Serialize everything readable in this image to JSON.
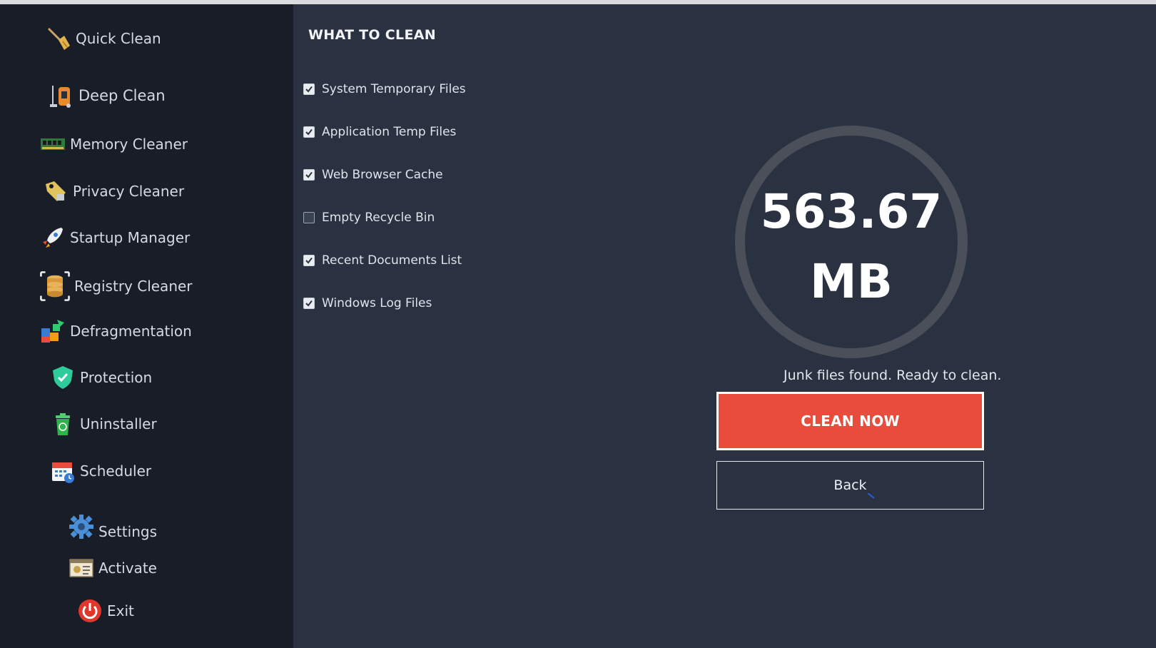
{
  "sidebar": {
    "items": [
      {
        "label": "Quick Clean",
        "icon": "broom-icon"
      },
      {
        "label": "Deep Clean",
        "icon": "vacuum-icon"
      },
      {
        "label": "Memory Cleaner",
        "icon": "ram-chip-icon"
      },
      {
        "label": "Privacy Cleaner",
        "icon": "tag-lock-icon"
      },
      {
        "label": "Startup Manager",
        "icon": "rocket-icon"
      },
      {
        "label": "Registry Cleaner",
        "icon": "database-icon"
      },
      {
        "label": "Defragmentation",
        "icon": "puzzle-icon"
      },
      {
        "label": "Protection",
        "icon": "shield-icon"
      },
      {
        "label": "Uninstaller",
        "icon": "trash-bin-icon"
      },
      {
        "label": "Scheduler",
        "icon": "calendar-clock-icon"
      },
      {
        "label": "Settings",
        "icon": "gear-icon"
      },
      {
        "label": "Activate",
        "icon": "license-icon"
      },
      {
        "label": "Exit",
        "icon": "power-icon"
      }
    ]
  },
  "main": {
    "section_title": "WHAT TO CLEAN",
    "options": [
      {
        "label": "System Temporary Files",
        "checked": true
      },
      {
        "label": "Application Temp Files",
        "checked": true
      },
      {
        "label": "Web Browser Cache",
        "checked": true
      },
      {
        "label": "Empty Recycle Bin",
        "checked": false
      },
      {
        "label": "Recent Documents List",
        "checked": true
      },
      {
        "label": "Windows Log Files",
        "checked": true
      }
    ],
    "scan_result": {
      "value": "563.67",
      "unit": "MB"
    },
    "status": "Junk files found. Ready to clean.",
    "clean_button": "CLEAN NOW",
    "back_button": "Back"
  },
  "colors": {
    "sidebar_bg": "#181d27",
    "main_bg": "#2a3241",
    "accent_red": "#e74c3c",
    "gauge_ring": "#4a4f5a"
  }
}
